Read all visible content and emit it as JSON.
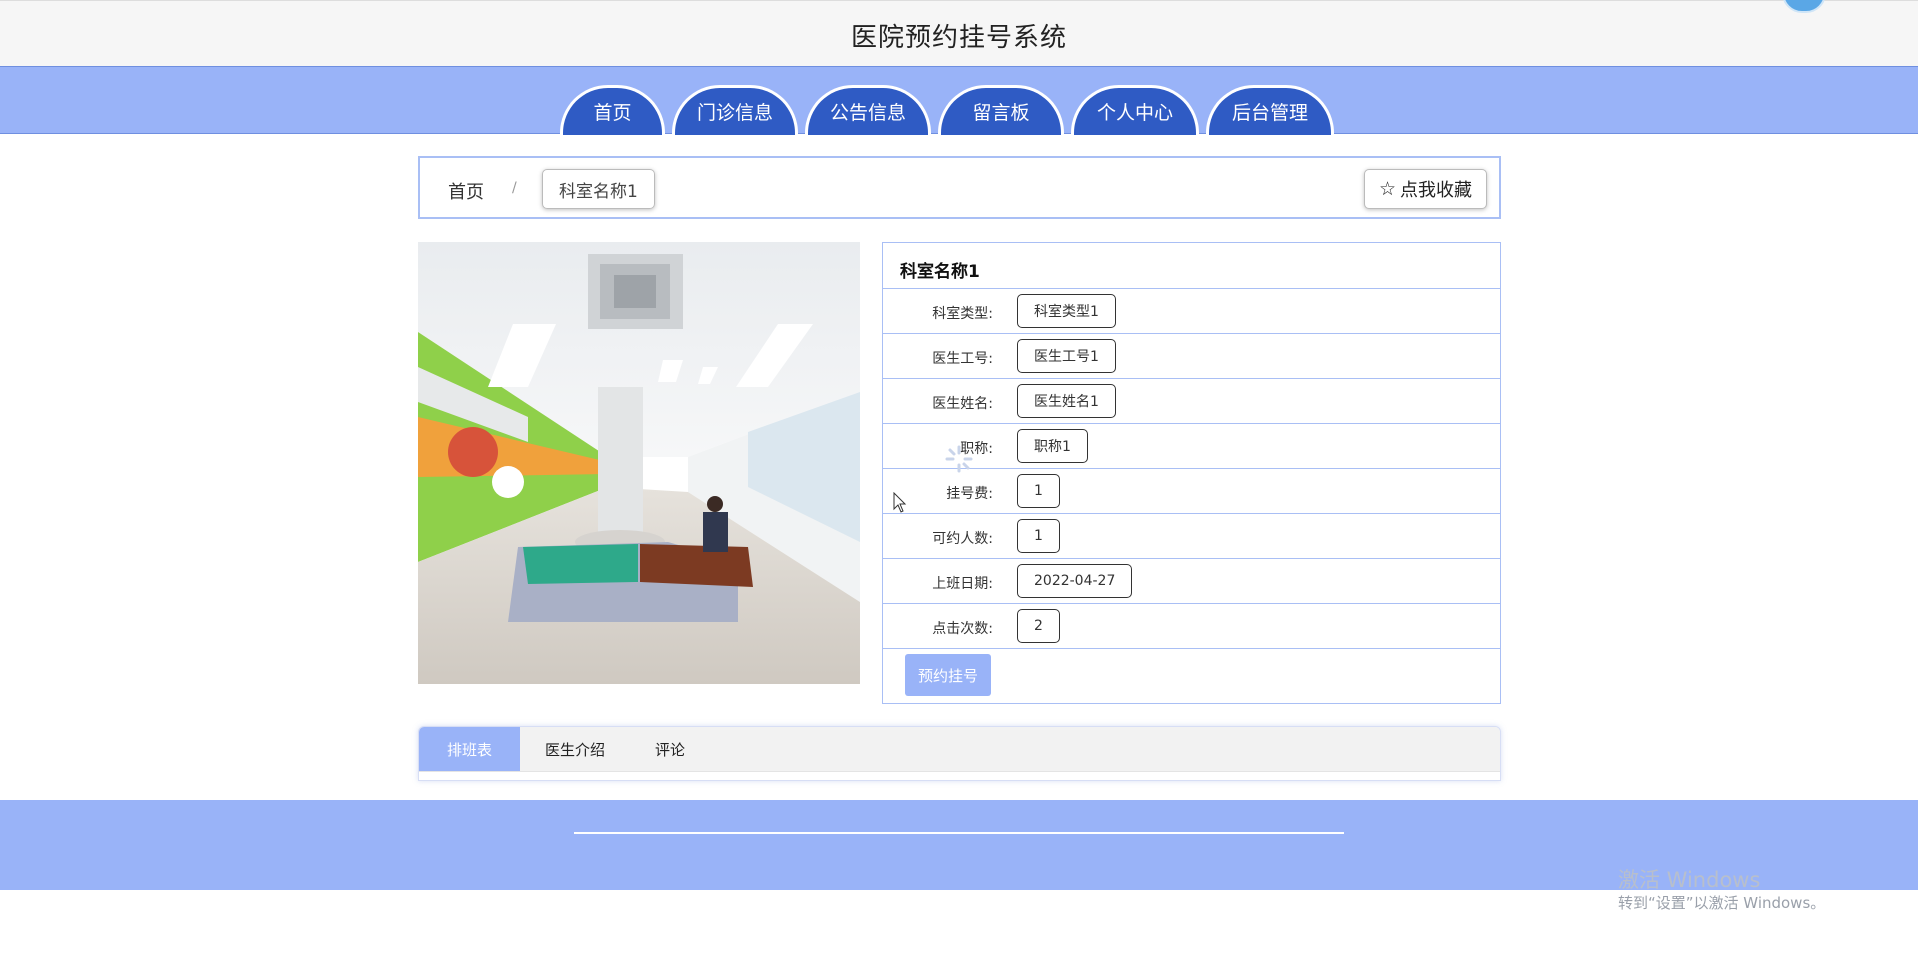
{
  "header": {
    "title": "医院预约挂号系统"
  },
  "nav": {
    "items": [
      {
        "label": "首页"
      },
      {
        "label": "门诊信息"
      },
      {
        "label": "公告信息"
      },
      {
        "label": "留言板"
      },
      {
        "label": "个人中心"
      },
      {
        "label": "后台管理"
      }
    ]
  },
  "breadcrumb": {
    "home": "首页",
    "separator": "/",
    "current": "科室名称1",
    "favorite_icon": "star-outline-icon",
    "favorite_label": "点我收藏"
  },
  "detail": {
    "title": "科室名称1",
    "rows": [
      {
        "label": "科室类型:",
        "value": "科室类型1"
      },
      {
        "label": "医生工号:",
        "value": "医生工号1"
      },
      {
        "label": "医生姓名:",
        "value": "医生姓名1"
      },
      {
        "label": "职称:",
        "value": "职称1"
      },
      {
        "label": "挂号费:",
        "value": "1"
      },
      {
        "label": "可约人数:",
        "value": "1"
      },
      {
        "label": "上班日期:",
        "value": "2022-04-27"
      },
      {
        "label": "点击次数:",
        "value": "2"
      }
    ],
    "book_label": "预约挂号"
  },
  "tabs": [
    {
      "label": "排班表",
      "active": true
    },
    {
      "label": "医生介绍",
      "active": false
    },
    {
      "label": "评论",
      "active": false
    }
  ],
  "watermark": {
    "line1": "激活 Windows",
    "line2": "转到“设置”以激活 Windows。"
  },
  "colors": {
    "accent": "#99b3f8",
    "nav_tab": "#2f5bc4",
    "border": "#a9bff5"
  }
}
